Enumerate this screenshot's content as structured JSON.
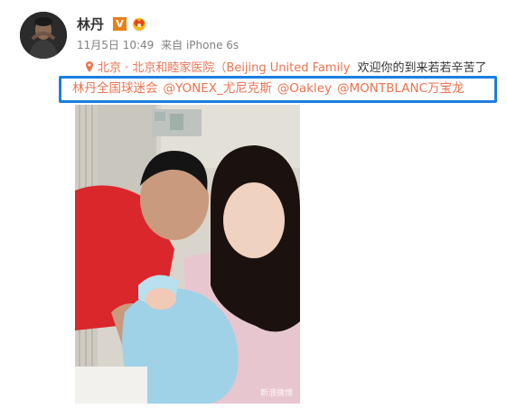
{
  "post": {
    "username": "林丹",
    "verified_badge": "V",
    "timestamp": "11月5日 10:49",
    "source": "来自 iPhone 6s",
    "location": "北京 · 北京和睦家医院（Beijing United Family",
    "text_line1": "欢迎你的到来若若辛苦了",
    "mentions": [
      "林丹全国球迷会",
      "@YONEX_尤尼克斯",
      "@Oakley",
      "@MONTBLANC万宝龙"
    ],
    "watermark": "新浪微博"
  },
  "icons": {
    "avatar": "avatar-photo",
    "verified": "verified-v-icon",
    "member": "crown-icon",
    "location": "location-pin-icon"
  },
  "colors": {
    "link": "#eb7350",
    "highlight_border": "#1c7fe0",
    "verified_orange": "#e8811b",
    "meta_gray": "#808080"
  }
}
